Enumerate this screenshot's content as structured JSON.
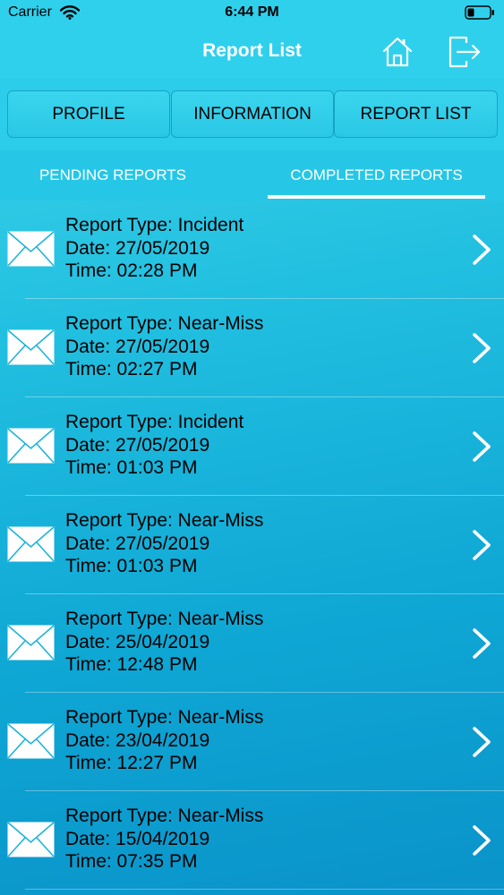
{
  "status_bar": {
    "carrier": "Carrier",
    "time": "6:44 PM"
  },
  "nav": {
    "title": "Report List"
  },
  "top_tabs": [
    {
      "label": "PROFILE"
    },
    {
      "label": "INFORMATION"
    },
    {
      "label": "REPORT LIST"
    }
  ],
  "sub_tabs": [
    {
      "label": "PENDING REPORTS",
      "selected": false
    },
    {
      "label": "COMPLETED REPORTS",
      "selected": true
    }
  ],
  "reports": [
    {
      "type": "Report Type: Incident",
      "date": "Date: 27/05/2019",
      "time": "Time: 02:28 PM"
    },
    {
      "type": "Report Type: Near-Miss",
      "date": "Date: 27/05/2019",
      "time": "Time: 02:27 PM"
    },
    {
      "type": "Report Type: Incident",
      "date": "Date: 27/05/2019",
      "time": "Time: 01:03 PM"
    },
    {
      "type": "Report Type: Near-Miss",
      "date": "Date: 27/05/2019",
      "time": "Time: 01:03 PM"
    },
    {
      "type": "Report Type: Near-Miss",
      "date": "Date: 25/04/2019",
      "time": "Time: 12:48 PM"
    },
    {
      "type": "Report Type: Near-Miss",
      "date": "Date: 23/04/2019",
      "time": "Time: 12:27 PM"
    },
    {
      "type": "Report Type: Near-Miss",
      "date": "Date: 15/04/2019",
      "time": "Time: 07:35 PM"
    }
  ],
  "colors": {
    "header": "#2fd0ec",
    "accent": "#ffffff",
    "background_bottom": "#0a93c9"
  }
}
